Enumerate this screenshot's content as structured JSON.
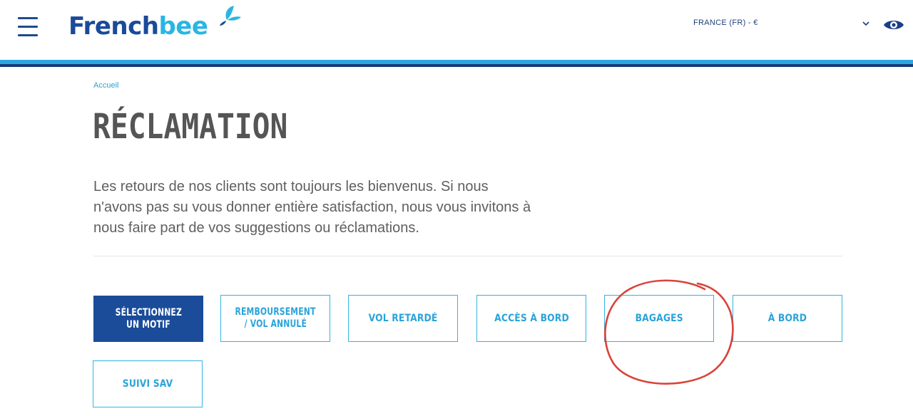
{
  "header": {
    "logo": {
      "part1": "French",
      "part2": "bee"
    },
    "region_label": "FRANCE (FR) - €"
  },
  "breadcrumb": {
    "home": "Accueil"
  },
  "page": {
    "title": "RÉCLAMATION",
    "intro": "Les retours de nos clients sont toujours les bienvenus. Si nous n'avons pas su vous donner entière satisfaction, nous vous invitons à nous faire part de vos suggestions ou réclamations."
  },
  "motifs": {
    "select": {
      "line1": "SÉLECTIONNEZ",
      "line2": "UN MOTIF"
    },
    "remboursement": {
      "line1": "REMBOURSEMENT",
      "line2": "/ VOL ANNULÉ"
    },
    "vol_retarde": "VOL RETARDÉ",
    "acces_bord": "ACCÈS À BORD",
    "bagages": "BAGAGES",
    "a_bord": "À BORD",
    "suivi_sav": "SUIVI SAV"
  },
  "colors": {
    "brand_dark": "#1a4c9a",
    "brand_light": "#2aa3d9",
    "annotation": "#d9433a"
  },
  "icons": [
    "hamburger-menu-icon",
    "butterfly-logo-icon",
    "chevron-down-icon",
    "eye-icon"
  ]
}
